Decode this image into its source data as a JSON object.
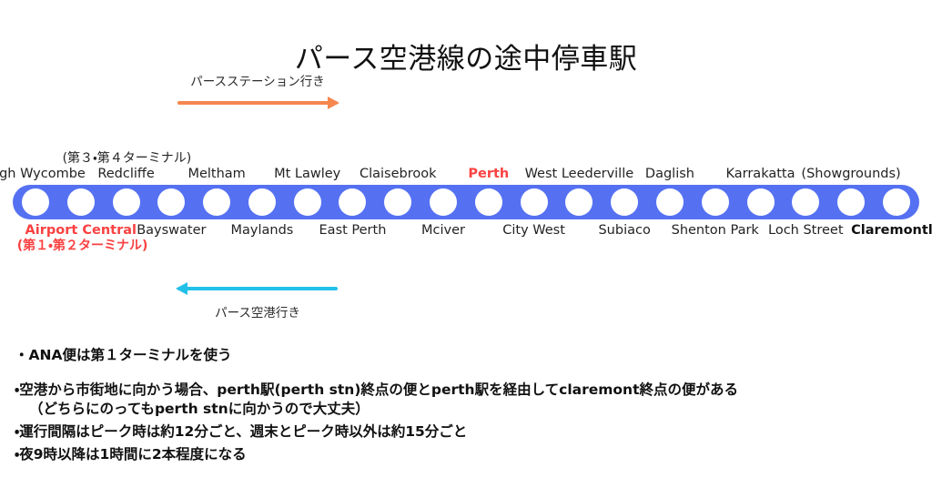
{
  "page": {
    "title": "パース空港線の途中停車駅"
  },
  "directions": {
    "to_perth_station": {
      "label": "パースステーション行き",
      "arrow": "arrow-right",
      "color": "#F5874F"
    },
    "to_airport": {
      "label": "パース空港行き",
      "arrow": "arrow-left",
      "color": "#22C0E8"
    }
  },
  "line": {
    "color": "#5571F2",
    "dot_color": "#FFFFFF",
    "station_count": 20
  },
  "stations": [
    {
      "index": 1,
      "name": "High Wycombe",
      "side": "top",
      "style": "normal",
      "note": null
    },
    {
      "index": 2,
      "name": "Airport Central",
      "side": "bottom",
      "style": "red",
      "note": "(第１・第２ターミナル)"
    },
    {
      "index": 3,
      "name": "Redcliffe",
      "side": "top",
      "style": "normal",
      "note": "(第３・第４ターミナル)"
    },
    {
      "index": 4,
      "name": "Bayswater",
      "side": "bottom",
      "style": "normal",
      "note": null
    },
    {
      "index": 5,
      "name": "Meltham",
      "side": "top",
      "style": "normal",
      "note": null
    },
    {
      "index": 6,
      "name": "Maylands",
      "side": "bottom",
      "style": "normal",
      "note": null
    },
    {
      "index": 7,
      "name": "Mt Lawley",
      "side": "top",
      "style": "normal",
      "note": null
    },
    {
      "index": 8,
      "name": "East Perth",
      "side": "bottom",
      "style": "normal",
      "note": null
    },
    {
      "index": 9,
      "name": "Claisebrook",
      "side": "top",
      "style": "normal",
      "note": null
    },
    {
      "index": 10,
      "name": "Mciver",
      "side": "bottom",
      "style": "normal",
      "note": null
    },
    {
      "index": 11,
      "name": "Perth",
      "side": "top",
      "style": "red",
      "note": null
    },
    {
      "index": 12,
      "name": "City West",
      "side": "bottom",
      "style": "normal",
      "note": null
    },
    {
      "index": 13,
      "name": "West Leederville",
      "side": "top",
      "style": "normal",
      "note": null
    },
    {
      "index": 14,
      "name": "Subiaco",
      "side": "bottom",
      "style": "normal",
      "note": null
    },
    {
      "index": 15,
      "name": "Daglish",
      "side": "top",
      "style": "normal",
      "note": null
    },
    {
      "index": 16,
      "name": "Shenton Park",
      "side": "bottom",
      "style": "normal",
      "note": null
    },
    {
      "index": 17,
      "name": "Karrakatta",
      "side": "top",
      "style": "normal",
      "note": null
    },
    {
      "index": 18,
      "name": "Loch Street",
      "side": "bottom",
      "style": "normal",
      "note": null
    },
    {
      "index": 19,
      "name": "(Showgrounds)",
      "side": "top",
      "style": "normal",
      "note": null
    },
    {
      "index": 20,
      "name": "Claremontle",
      "side": "bottom",
      "style": "bold",
      "note": null
    }
  ],
  "notes": [
    {
      "text": "・ANA便は第１ターミナルを使う",
      "variant": "first"
    },
    {
      "text": "・空港から市街地に向かう場合、perth駅(perth stn)終点の便とperth駅を経由してclaremont終点の便がある",
      "variant": "spaced"
    },
    {
      "text": "（どちらにのってもperth  stnに向かうので大丈夫）",
      "variant": "indent"
    },
    {
      "text": "・運行間隔はピーク時は約12分ごと、週末とピーク時以外は約15分ごと",
      "variant": "tight"
    },
    {
      "text": "・夜9時以降は1時間に2本程度になる",
      "variant": "tight"
    }
  ]
}
